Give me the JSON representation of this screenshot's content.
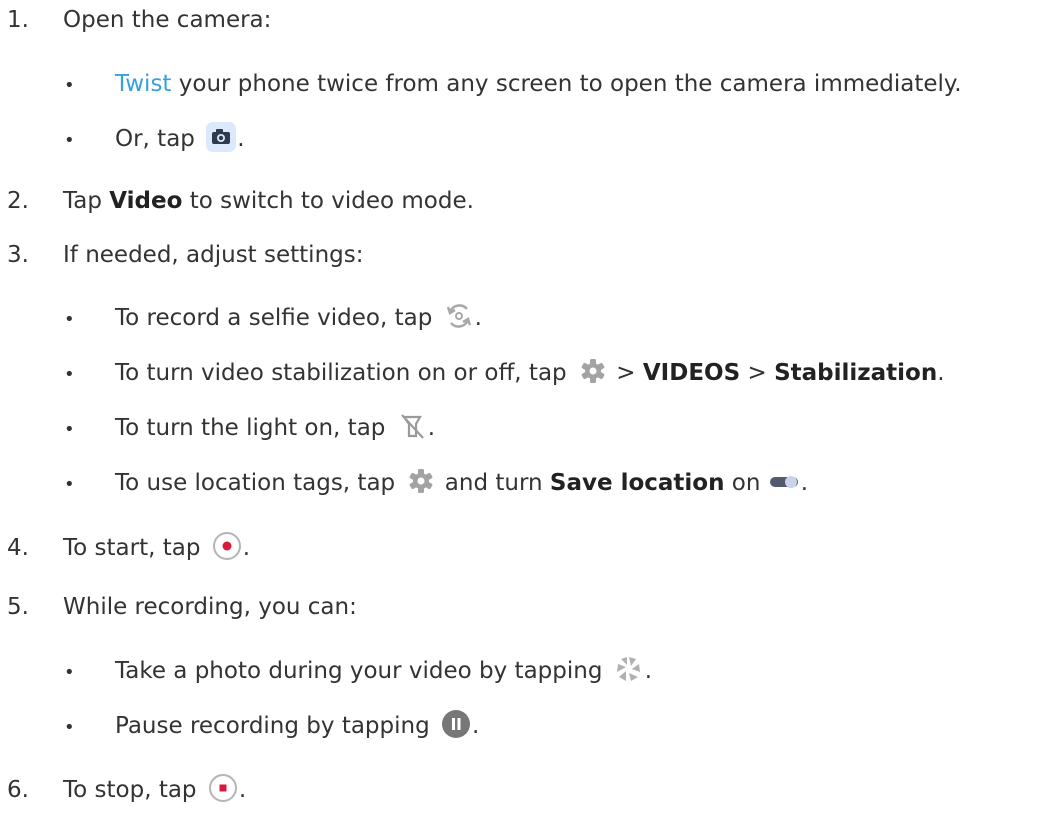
{
  "steps": [
    {
      "number": "1.",
      "text": "Open the camera:"
    },
    {
      "number": "2.",
      "pre": "Tap ",
      "bold": "Video",
      "post": " to switch to video mode."
    },
    {
      "number": "3.",
      "text": "If needed, adjust settings:"
    },
    {
      "number": "4.",
      "pre": "To start, tap ",
      "post": "."
    },
    {
      "number": "5.",
      "text": "While recording, you can:"
    },
    {
      "number": "6.",
      "pre": "To stop, tap ",
      "post": "."
    }
  ],
  "open_camera": {
    "twist_link": "Twist",
    "twist_rest": " your phone twice from any screen to open the camera immediately.",
    "or_tap": "Or, tap ",
    "period": "."
  },
  "settings": {
    "selfie_pre": "To record a selfie video, tap ",
    "selfie_post": ".",
    "stab_pre": "To turn video stabilization on or off, tap ",
    "stab_sep1": " > ",
    "stab_bold1": "VIDEOS",
    "stab_sep2": " > ",
    "stab_bold2": "Stabilization",
    "stab_post": ".",
    "light_pre": "To turn the light on, tap ",
    "light_post": ".",
    "loc_pre": "To use location tags, tap ",
    "loc_mid": " and turn ",
    "loc_bold": "Save location",
    "loc_on": " on ",
    "loc_post": "."
  },
  "recording": {
    "photo_pre": "Take a photo during your video by tapping ",
    "photo_post": ".",
    "pause_pre": "Pause recording by tapping ",
    "pause_post": "."
  },
  "bullet": "•",
  "colors": {
    "link": "#37a0e0",
    "record_red": "#d81b3c",
    "icon_gray": "#9a9a9a",
    "pause_gray": "#777777"
  },
  "icons": [
    "camera-icon",
    "switch-camera-icon",
    "settings-gear-icon",
    "flash-off-icon",
    "toggle-switch-icon",
    "record-button-icon",
    "shutter-aperture-icon",
    "pause-button-icon",
    "stop-button-icon"
  ]
}
